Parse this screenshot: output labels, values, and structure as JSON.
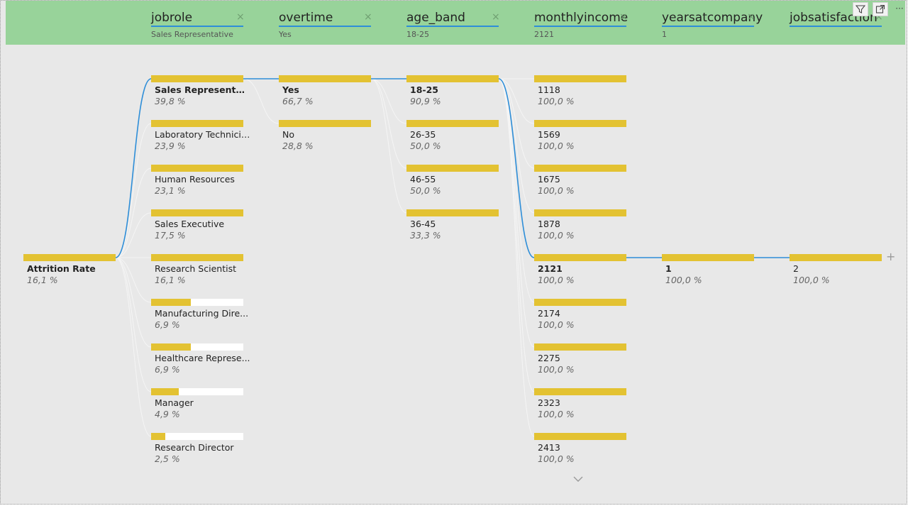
{
  "toolbar": {
    "filter_icon": "filter-icon",
    "focus_icon": "focus-mode-icon",
    "more_icon": "more-options-icon",
    "more_label": "···"
  },
  "levels": [
    {
      "name": "jobrole",
      "value": "Sales Representative"
    },
    {
      "name": "overtime",
      "value": "Yes"
    },
    {
      "name": "age_band",
      "value": "18-25"
    },
    {
      "name": "monthlyincome",
      "value": "2121"
    },
    {
      "name": "yearsatcompany",
      "value": "1"
    },
    {
      "name": "jobsatisfaction",
      "value": ""
    }
  ],
  "close_glyph": "×",
  "plus_glyph": "+",
  "root": {
    "label": "Attrition Rate",
    "pct": "16,1 %",
    "fill": 1.0
  },
  "columns": [
    {
      "nodes": [
        {
          "label": "Sales Representative",
          "pct": "39,8 %",
          "fill": 1.0,
          "selected": true
        },
        {
          "label": "Laboratory Technician",
          "pct": "23,9 %",
          "fill": 1.0,
          "selected": false
        },
        {
          "label": "Human Resources",
          "pct": "23,1 %",
          "fill": 1.0,
          "selected": false
        },
        {
          "label": "Sales Executive",
          "pct": "17,5 %",
          "fill": 1.0,
          "selected": false
        },
        {
          "label": "Research Scientist",
          "pct": "16,1 %",
          "fill": 1.0,
          "selected": false
        },
        {
          "label": "Manufacturing Dire...",
          "pct": "6,9 %",
          "fill": 0.43,
          "selected": false
        },
        {
          "label": "Healthcare Represe...",
          "pct": "6,9 %",
          "fill": 0.43,
          "selected": false
        },
        {
          "label": "Manager",
          "pct": "4,9 %",
          "fill": 0.3,
          "selected": false
        },
        {
          "label": "Research Director",
          "pct": "2,5 %",
          "fill": 0.15,
          "selected": false
        }
      ]
    },
    {
      "nodes": [
        {
          "label": "Yes",
          "pct": "66,7 %",
          "fill": 1.0,
          "selected": true
        },
        {
          "label": "No",
          "pct": "28,8 %",
          "fill": 1.0,
          "selected": false
        }
      ]
    },
    {
      "nodes": [
        {
          "label": "18-25",
          "pct": "90,9 %",
          "fill": 1.0,
          "selected": true
        },
        {
          "label": "26-35",
          "pct": "50,0 %",
          "fill": 1.0,
          "selected": false
        },
        {
          "label": "46-55",
          "pct": "50,0 %",
          "fill": 1.0,
          "selected": false
        },
        {
          "label": "36-45",
          "pct": "33,3 %",
          "fill": 1.0,
          "selected": false
        }
      ]
    },
    {
      "nodes": [
        {
          "label": "1118",
          "pct": "100,0 %",
          "fill": 1.0,
          "selected": false
        },
        {
          "label": "1569",
          "pct": "100,0 %",
          "fill": 1.0,
          "selected": false
        },
        {
          "label": "1675",
          "pct": "100,0 %",
          "fill": 1.0,
          "selected": false
        },
        {
          "label": "1878",
          "pct": "100,0 %",
          "fill": 1.0,
          "selected": false
        },
        {
          "label": "2121",
          "pct": "100,0 %",
          "fill": 1.0,
          "selected": true
        },
        {
          "label": "2174",
          "pct": "100,0 %",
          "fill": 1.0,
          "selected": false
        },
        {
          "label": "2275",
          "pct": "100,0 %",
          "fill": 1.0,
          "selected": false
        },
        {
          "label": "2323",
          "pct": "100,0 %",
          "fill": 1.0,
          "selected": false
        },
        {
          "label": "2413",
          "pct": "100,0 %",
          "fill": 1.0,
          "selected": false
        }
      ]
    },
    {
      "nodes": [
        {
          "label": "1",
          "pct": "100,0 %",
          "fill": 1.0,
          "selected": true
        }
      ]
    },
    {
      "nodes": [
        {
          "label": "2",
          "pct": "100,0 %",
          "fill": 1.0,
          "selected": false
        }
      ]
    }
  ],
  "colors": {
    "header_bg": "#98d39a",
    "bar": "#e3c232",
    "link_selected": "#2e8ed8",
    "link_other": "#f5f5f5",
    "canvas": "#e8e8e8"
  },
  "scroll_icon": "chevron-down-icon"
}
